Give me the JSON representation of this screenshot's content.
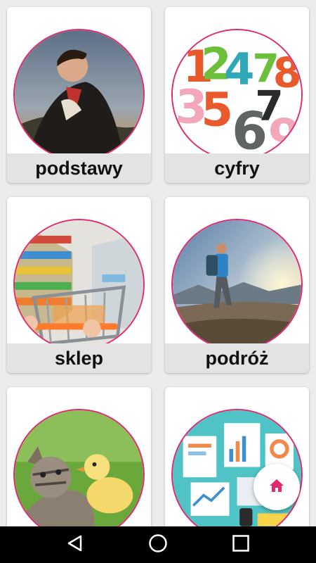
{
  "categories": [
    {
      "label": "podstawy",
      "image": "portrait-painting"
    },
    {
      "label": "cyfry",
      "image": "colorful-numbers"
    },
    {
      "label": "sklep",
      "image": "supermarket-cart"
    },
    {
      "label": "podróż",
      "image": "hiker-mountains"
    },
    {
      "label": "",
      "image": "kitten-and-duckling"
    },
    {
      "label": "",
      "image": "office-desk-papers"
    }
  ],
  "fab": {
    "icon": "home-icon",
    "color": "#e0296e"
  },
  "navbar": {
    "back_icon": "back-triangle-icon",
    "home_icon": "home-circle-icon",
    "recents_icon": "recents-square-icon"
  },
  "colors": {
    "accent": "#e0296e",
    "label_bar": "#e3e3e3",
    "background": "#ececec"
  }
}
